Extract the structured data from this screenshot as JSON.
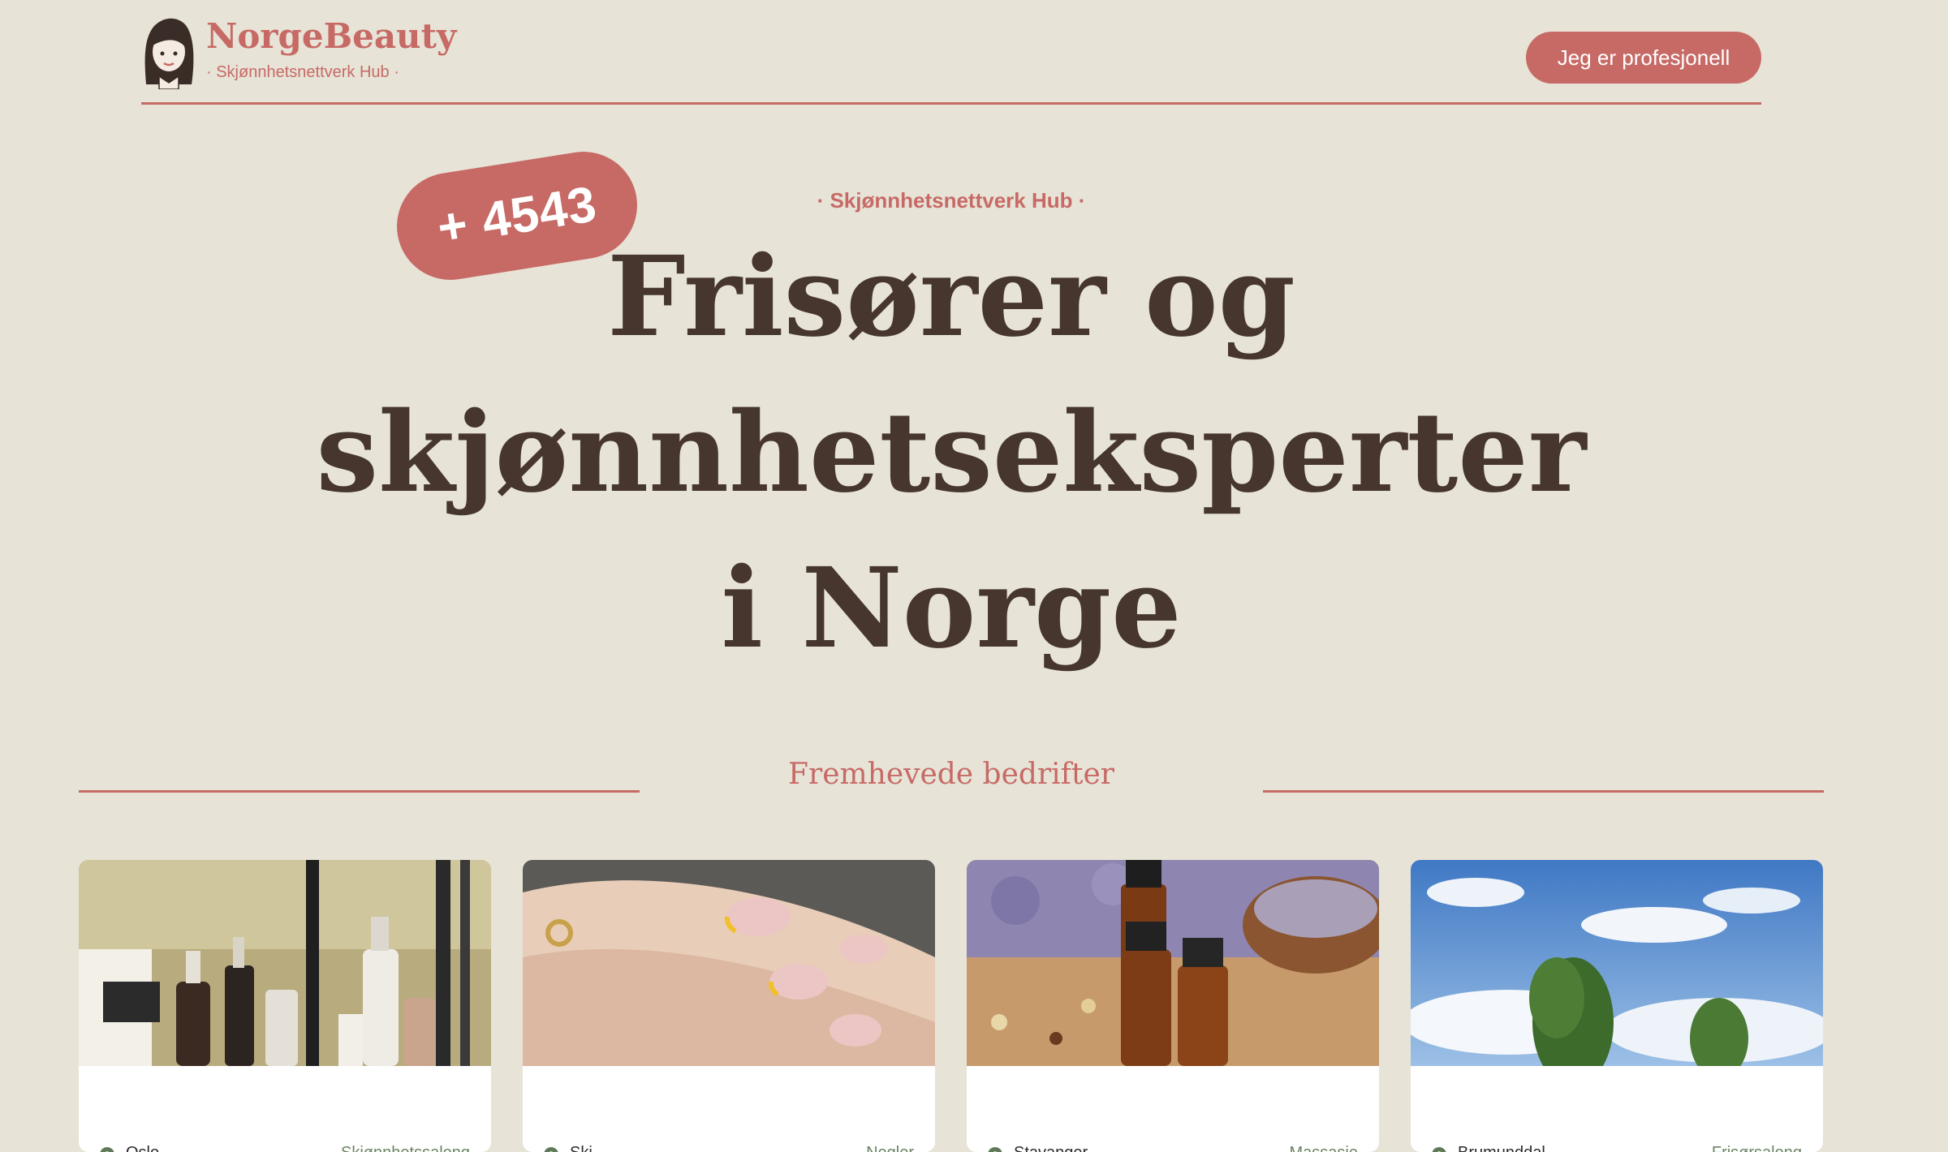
{
  "brand": {
    "name": "NorgeBeauty",
    "tagline": "· Skjønnhetsnettverk Hub ·"
  },
  "header": {
    "pro_button_label": "Jeg er profesjonell"
  },
  "hero": {
    "count_badge": "+ 4543",
    "kicker": "· Skjønnhetsnettverk Hub ·",
    "title_line1": "Frisører og",
    "title_line2": "skjønnhetseksperter",
    "title_line3": "i Norge"
  },
  "featured": {
    "title": "Fremhevede bedrifter",
    "cards": [
      {
        "city": "Oslo",
        "category": "Skjønnhetssalong",
        "image": "beauty-products-shelf"
      },
      {
        "city": "Ski",
        "category": "Negler",
        "image": "manicured-nails"
      },
      {
        "city": "Stavanger",
        "category": "Massasje",
        "image": "essential-oils-lavender"
      },
      {
        "city": "Brumunddal",
        "category": "Frisørsalong",
        "image": "sky-and-trees"
      }
    ]
  },
  "colors": {
    "background": "#e7e3d7",
    "accent": "#c76a66",
    "heading": "#46362d",
    "category_text": "#6b8463"
  }
}
